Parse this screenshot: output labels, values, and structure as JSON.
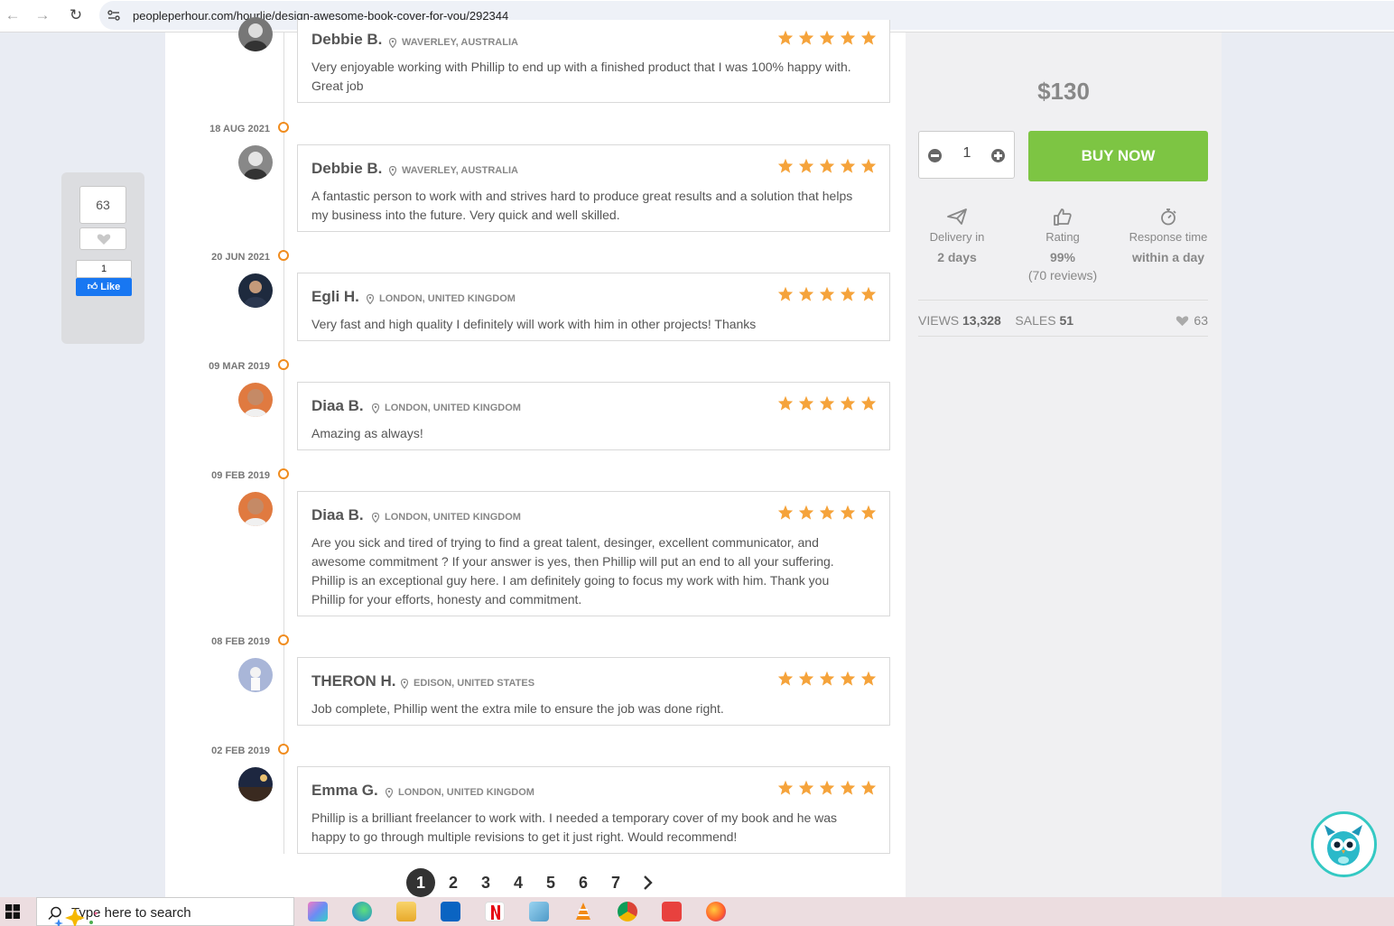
{
  "browser": {
    "url": "peopleperhour.com/hourlie/design-awesome-book-cover-for-you/292344"
  },
  "share": {
    "favorites_count": "63",
    "fb_count": "1",
    "fb_label": "Like"
  },
  "reviews": [
    {
      "date": "",
      "name": "Debbie B.",
      "location": "WAVERLEY, AUSTRALIA",
      "rating": 5,
      "text": "Very enjoyable working with Phillip to end up with a finished product that I was 100% happy with. Great job"
    },
    {
      "date": "18 AUG 2021",
      "name": "Debbie B.",
      "location": "WAVERLEY, AUSTRALIA",
      "rating": 5,
      "text": "A fantastic person to work with and strives hard to produce great results and a solution that helps my business into the future. Very quick and well skilled."
    },
    {
      "date": "20 JUN 2021",
      "name": "Egli H.",
      "location": "LONDON, UNITED KINGDOM",
      "rating": 5,
      "text": "Very fast and high quality I definitely will work with him in other projects! Thanks"
    },
    {
      "date": "09 MAR 2019",
      "name": "Diaa B.",
      "location": "LONDON, UNITED KINGDOM",
      "rating": 5,
      "text": "Amazing as always!"
    },
    {
      "date": "09 FEB 2019",
      "name": "Diaa B.",
      "location": "LONDON, UNITED KINGDOM",
      "rating": 5,
      "text": "Are you sick and tired of trying to find a great talent, desinger, excellent communicator, and awesome commitment ? If your answer is yes, then Phillip will put an end to all your suffering. Phillip is an exceptional guy here. I am definitely going to focus my work with him. Thank you Phillip for your efforts, honesty and commitment."
    },
    {
      "date": "08 FEB 2019",
      "name": "THERON H.",
      "location": "EDISON, UNITED STATES",
      "rating": 5,
      "text": "Job complete, Phillip went the extra mile to ensure the job was done right."
    },
    {
      "date": "02 FEB 2019",
      "name": "Emma G.",
      "location": "LONDON, UNITED KINGDOM",
      "rating": 5,
      "text": "Phillip is a brilliant freelancer to work with. I needed a temporary cover of my book and he was happy to go through multiple revisions to get it just right. Would recommend!"
    }
  ],
  "pagination": {
    "pages": [
      "1",
      "2",
      "3",
      "4",
      "5",
      "6",
      "7"
    ],
    "current": "1"
  },
  "sidebar": {
    "price": "$130",
    "quantity": "1",
    "buy_label": "BUY NOW",
    "delivery_label": "Delivery in",
    "delivery_value": "2 days",
    "rating_label": "Rating",
    "rating_value": "99%",
    "rating_sub": "(70 reviews)",
    "response_label": "Response time",
    "response_value": "within a day",
    "views_label": "VIEWS",
    "views_value": "13,328",
    "sales_label": "SALES",
    "sales_value": "51",
    "favorites": "63"
  },
  "taskbar": {
    "search_placeholder": "Type here to search"
  },
  "colors": {
    "accent_orange": "#f08c1e",
    "star": "#f5a33b",
    "buy_green": "#7dc543",
    "chat_ring": "#34c9c3"
  }
}
